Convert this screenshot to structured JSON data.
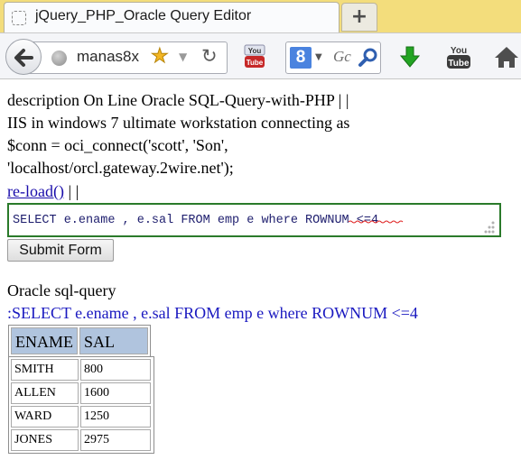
{
  "browser": {
    "tab_title": "jQuery_PHP_Oracle Query Editor",
    "new_tab_label": "+",
    "url": "manas8x",
    "search_placeholder": "Gc"
  },
  "description_lines": [
    "description On Line Oracle SQL-Query-with-PHP | |",
    "IIS in windows 7 ultimate workstation connecting as",
    "$conn = oci_connect('scott', 'Son',",
    "'localhost/orcl.gateway.2wire.net');"
  ],
  "reload": {
    "link_text": "re-load()",
    "suffix": " | |"
  },
  "sql_input": {
    "value": "SELECT e.ename , e.sal FROM emp e where ROWNUM <=4"
  },
  "submit_label": "Submit Form",
  "result": {
    "heading": "Oracle sql-query",
    "query_echo": ":SELECT e.ename , e.sal FROM emp e where ROWNUM <=4",
    "columns": [
      "ENAME",
      "SAL"
    ],
    "rows": [
      [
        "SMITH",
        "800"
      ],
      [
        "ALLEN",
        "1600"
      ],
      [
        "WARD",
        "1250"
      ],
      [
        "JONES",
        "2975"
      ]
    ]
  },
  "colors": {
    "accent_green_border": "#2a7a2a",
    "header_cell_bg": "#b0c4de",
    "query_echo_blue": "#1a19c0",
    "tabstrip_bg": "#f3dd7c"
  },
  "icons": [
    "page-icon",
    "add-tab-icon",
    "back-arrow-icon",
    "globe-icon",
    "bookmark-star-icon",
    "dropdown-arrow-icon",
    "reload-icon",
    "youtube-icon",
    "google-search-icon",
    "search-icon",
    "download-arrow-icon",
    "home-icon"
  ]
}
